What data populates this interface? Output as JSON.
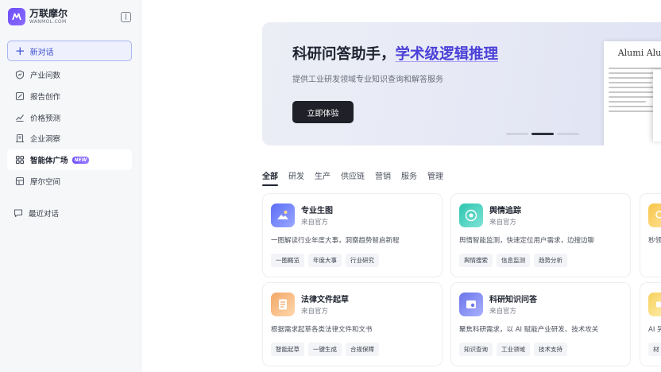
{
  "brand": {
    "name": "万联摩尔",
    "sub": "WANMOL.COM"
  },
  "sidebar": {
    "new_chat": "新对话",
    "items": [
      {
        "label": "产业问数",
        "icon": "chart-shield-icon"
      },
      {
        "label": "报告创作",
        "icon": "edit-icon"
      },
      {
        "label": "价格预测",
        "icon": "trend-icon"
      },
      {
        "label": "企业洞察",
        "icon": "building-icon"
      },
      {
        "label": "智能体广场",
        "icon": "grid-icon",
        "badge": "NEW"
      },
      {
        "label": "摩尔空间",
        "icon": "folder-icon"
      }
    ],
    "recent": "最近对话"
  },
  "banner": {
    "title_plain": "科研问答助手，",
    "title_highlight": "学术级逻辑推理",
    "subtitle": "提供工业研发领域专业知识查询和解答服务",
    "button": "立即体验",
    "paper_title": "Alumi Alu"
  },
  "tabs": [
    "全部",
    "研发",
    "生产",
    "供应链",
    "营销",
    "服务",
    "管理"
  ],
  "cards": [
    {
      "title": "专业生图",
      "source": "来自官方",
      "desc": "一图解读行业年度大事，洞察趋势智启新程",
      "tags": [
        "一图概览",
        "年度大事",
        "行业研究"
      ]
    },
    {
      "title": "舆情追踪",
      "source": "来自官方",
      "desc": "舆情智能监测，快速定位用户需求，边搜边聊",
      "tags": [
        "舆情搜索",
        "信息监测",
        "趋势分析"
      ]
    },
    {
      "title": "",
      "source": "",
      "desc": "秒领",
      "tags": []
    },
    {
      "title": "法律文件起草",
      "source": "来自官方",
      "desc": "根据需求起草各类法律文件和文书",
      "tags": [
        "智能起草",
        "一键生成",
        "合规保障"
      ]
    },
    {
      "title": "科研知识问答",
      "source": "来自官方",
      "desc": "聚焦科研需求，以 AI 赋能产业研发、技术攻关",
      "tags": [
        "知识查询",
        "工业领域",
        "技术支持"
      ]
    },
    {
      "title": "",
      "source": "",
      "desc": "AI 另",
      "tags": [
        "材"
      ]
    }
  ],
  "colors": {
    "accent": "#4a40d8",
    "brand": "#6b4df7"
  }
}
